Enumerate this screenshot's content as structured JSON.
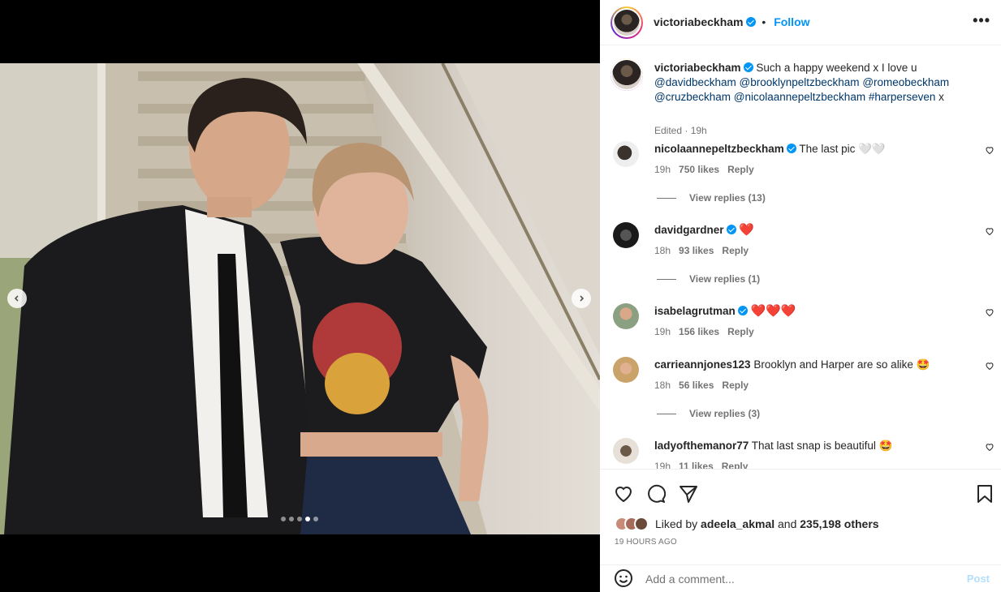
{
  "post": {
    "author": "victoriabeckham",
    "follow_label": "Follow",
    "separator": "•",
    "more_label": "•••",
    "caption": {
      "text_main": "Such a happy weekend x I love u",
      "mentions": [
        "@davidbeckham",
        "@brooklynpeltzbeckham",
        "@romeobeckham",
        "@cruzbeckham",
        "@nicolaannepeltzbeckham"
      ],
      "hashtag": "#harperseven",
      "tail": "x",
      "meta": "Edited · 19h"
    },
    "carousel": {
      "count": 5,
      "active_index": 3
    }
  },
  "comments": [
    {
      "user": "nicolaannepeltzbeckham",
      "verified": true,
      "text": "The last pic 🤍🤍",
      "time": "19h",
      "likes": "750 likes",
      "reply": "Reply",
      "replies": "View replies (13)"
    },
    {
      "user": "davidgardner",
      "verified": true,
      "text": "❤️",
      "time": "18h",
      "likes": "93 likes",
      "reply": "Reply",
      "replies": "View replies (1)"
    },
    {
      "user": "isabelagrutman",
      "verified": true,
      "text": "❤️❤️❤️",
      "time": "19h",
      "likes": "156 likes",
      "reply": "Reply",
      "replies": ""
    },
    {
      "user": "carrieannjones123",
      "verified": false,
      "text": "Brooklyn and Harper are so alike 🤩",
      "time": "18h",
      "likes": "56 likes",
      "reply": "Reply",
      "replies": "View replies (3)"
    },
    {
      "user": "ladyofthemanor77",
      "verified": false,
      "text": "That last snap is beautiful 🤩",
      "time": "19h",
      "likes": "11 likes",
      "reply": "Reply",
      "replies": ""
    }
  ],
  "likes": {
    "prefix": "Liked by",
    "user": "adeela_akmal",
    "and": "and",
    "others": "235,198 others"
  },
  "time_ago": "19 HOURS AGO",
  "add_comment": {
    "placeholder": "Add a comment...",
    "post_label": "Post"
  },
  "icons": {
    "like": "heart-icon",
    "comment": "comment-icon",
    "share": "send-icon",
    "save": "bookmark-icon",
    "emoji": "smiley-icon",
    "prev": "chevron-left-icon",
    "next": "chevron-right-icon"
  },
  "colors": {
    "accent": "#0095f6",
    "verified": "#0095f6",
    "link": "#00376b",
    "muted": "#737373"
  }
}
